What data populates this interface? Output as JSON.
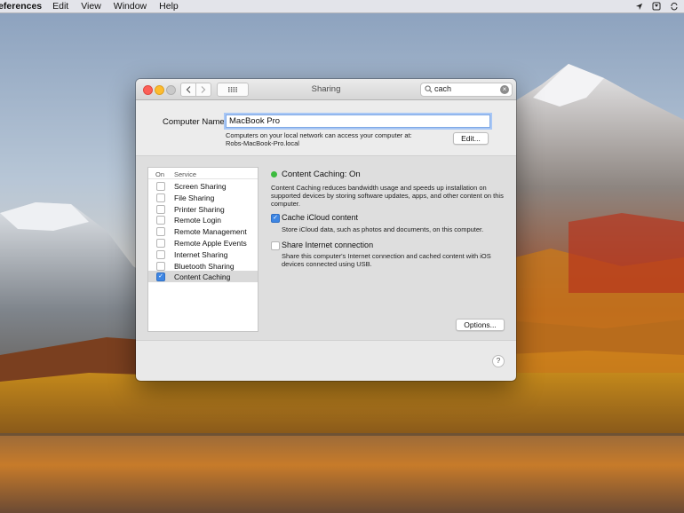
{
  "menubar": {
    "app_name": "references",
    "items": [
      "Edit",
      "View",
      "Window",
      "Help"
    ]
  },
  "window": {
    "title": "Sharing",
    "search_value": "cach",
    "computer_name_label": "Computer Name:",
    "computer_name_value": "MacBook Pro",
    "hint_line1": "Computers on your local network can access your computer at:",
    "hint_line2": "Robs-MacBook-Pro.local",
    "edit_button": "Edit...",
    "list_header_on": "On",
    "list_header_service": "Service",
    "services": [
      {
        "label": "Screen Sharing",
        "checked": false,
        "selected": false
      },
      {
        "label": "File Sharing",
        "checked": false,
        "selected": false
      },
      {
        "label": "Printer Sharing",
        "checked": false,
        "selected": false
      },
      {
        "label": "Remote Login",
        "checked": false,
        "selected": false
      },
      {
        "label": "Remote Management",
        "checked": false,
        "selected": false
      },
      {
        "label": "Remote Apple Events",
        "checked": false,
        "selected": false
      },
      {
        "label": "Internet Sharing",
        "checked": false,
        "selected": false
      },
      {
        "label": "Bluetooth Sharing",
        "checked": false,
        "selected": false
      },
      {
        "label": "Content Caching",
        "checked": true,
        "selected": true
      }
    ],
    "status": "Content Caching: On",
    "status_color": "#3dbb3f",
    "description": "Content Caching reduces bandwidth usage and speeds up installation on supported devices by storing software updates, apps, and other content on this computer.",
    "option1_label": "Cache iCloud content",
    "option1_checked": true,
    "option1_sub": "Store iCloud data, such as photos and documents, on this computer.",
    "option2_label": "Share Internet connection",
    "option2_checked": false,
    "option2_sub": "Share this computer's Internet connection and cached content with iOS devices connected using USB.",
    "options_button": "Options...",
    "help_label": "?"
  },
  "colors": {
    "accent": "#3e86e3",
    "close": "#fc5f57",
    "minimize": "#fdbc2e"
  }
}
